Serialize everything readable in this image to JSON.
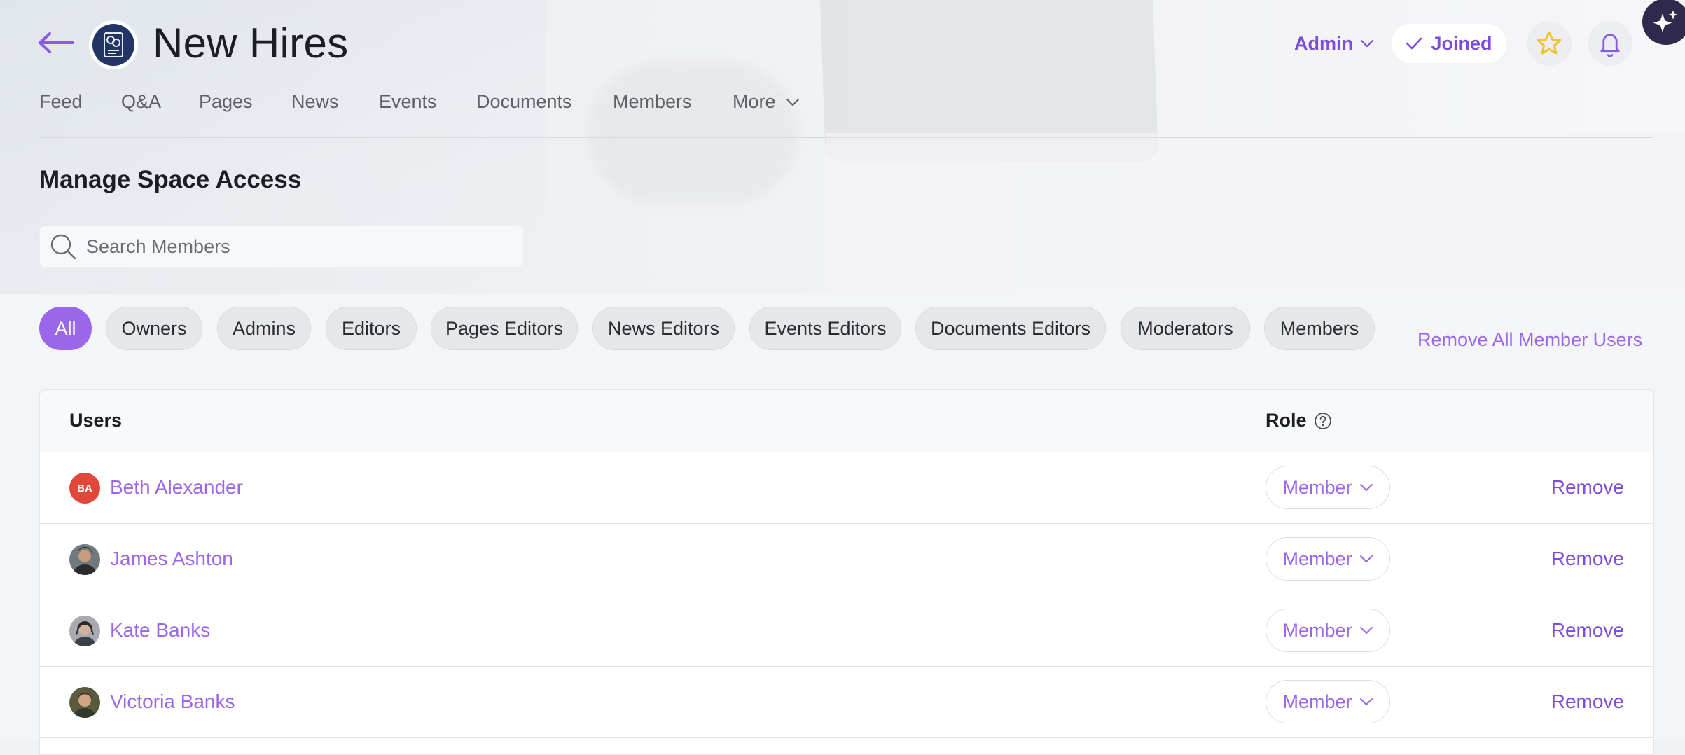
{
  "header": {
    "title": "New Hires",
    "admin_label": "Admin",
    "joined_label": "Joined"
  },
  "tabs": [
    "Feed",
    "Q&A",
    "Pages",
    "News",
    "Events",
    "Documents",
    "Members",
    "More"
  ],
  "section_title": "Manage Space Access",
  "search": {
    "placeholder": "Search Members",
    "value": ""
  },
  "filters": {
    "selected": "All",
    "chips": [
      "All",
      "Owners",
      "Admins",
      "Editors",
      "Pages Editors",
      "News Editors",
      "Events Editors",
      "Documents Editors",
      "Moderators",
      "Members"
    ]
  },
  "remove_all_label": "Remove All Member Users",
  "table": {
    "columns": {
      "users": "Users",
      "role": "Role"
    },
    "rows": [
      {
        "name": "Beth Alexander",
        "initials": "BA",
        "role": "Member",
        "action": "Remove"
      },
      {
        "name": "James Ashton",
        "role": "Member",
        "action": "Remove"
      },
      {
        "name": "Kate Banks",
        "role": "Member",
        "action": "Remove"
      },
      {
        "name": "Victoria Banks",
        "role": "Member",
        "action": "Remove"
      }
    ]
  },
  "colors": {
    "accent": "#9a67ea",
    "accent_dark": "#7c4ddb",
    "logo_bg": "#223564",
    "initials_avatar": "#e2473c",
    "star": "#f2c230"
  },
  "icons": [
    "back-arrow-icon",
    "space-logo-icon",
    "chevron-down-icon",
    "check-icon",
    "star-icon",
    "bell-icon",
    "sparkle-icon",
    "search-icon",
    "help-circle-icon"
  ]
}
